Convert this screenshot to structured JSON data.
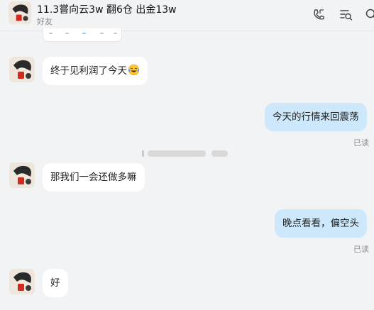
{
  "header": {
    "title": "11.3嘗向云3w 翻6仓 出金13w",
    "subtitle": "好友",
    "icons": [
      "call-icon",
      "notes-icon",
      "search-icon"
    ]
  },
  "messages": [
    {
      "side": "in",
      "text": "终于见利润了今天",
      "emoji": "laughing-tears-emoji"
    },
    {
      "side": "out",
      "text": "今天的行情来回震荡",
      "status": "已读"
    },
    {
      "side": "in",
      "text": "那我们一会还做多嘛"
    },
    {
      "side": "out",
      "text": "晚点看看，偏空头",
      "status": "已读"
    },
    {
      "side": "in",
      "text": "好"
    }
  ],
  "colors": {
    "background": "#f2f3f5",
    "incoming_bubble": "#ffffff",
    "outgoing_bubble": "#cde8fb",
    "read_status": "#8f8f8f"
  }
}
